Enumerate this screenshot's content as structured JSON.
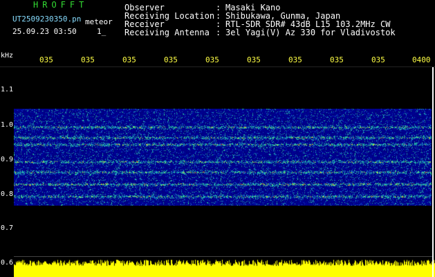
{
  "header": {
    "brand": "HROFFT",
    "filename": "UT2509230350.pn",
    "mode": "meteor",
    "datetime": "25.09.23 03:50",
    "cursor": "1_"
  },
  "meta": [
    {
      "label": "Observer",
      "value": "Masaki Kano"
    },
    {
      "label": "Receiving Location",
      "value": "Shibukawa, Gunma, Japan"
    },
    {
      "label": "Receiver",
      "value": "RTL-SDR SDR# 43dB L15 103.2MHz CW"
    },
    {
      "label": "Receiving Antenna",
      "value": "3el Yagi(V) Az 330 for Vladivostok"
    }
  ],
  "meta_separator": ":",
  "y_axis": {
    "unit": "kHz",
    "ticks": [
      "1.1",
      "1.0",
      "0.9",
      "0.8",
      "0.7",
      "0.6"
    ]
  },
  "x_axis": {
    "ticks": [
      "035",
      "035",
      "035",
      "035",
      "035",
      "035",
      "035",
      "035",
      "035",
      "0400"
    ]
  },
  "colors": {
    "background": "#000000",
    "spectrogram_base": "#00008c",
    "band": "#33cc99",
    "power_bar": "#ffff00"
  },
  "spectrogram": {
    "bands_khz": [
      0.995,
      0.965,
      0.945,
      0.895,
      0.865,
      0.83,
      0.795
    ]
  }
}
